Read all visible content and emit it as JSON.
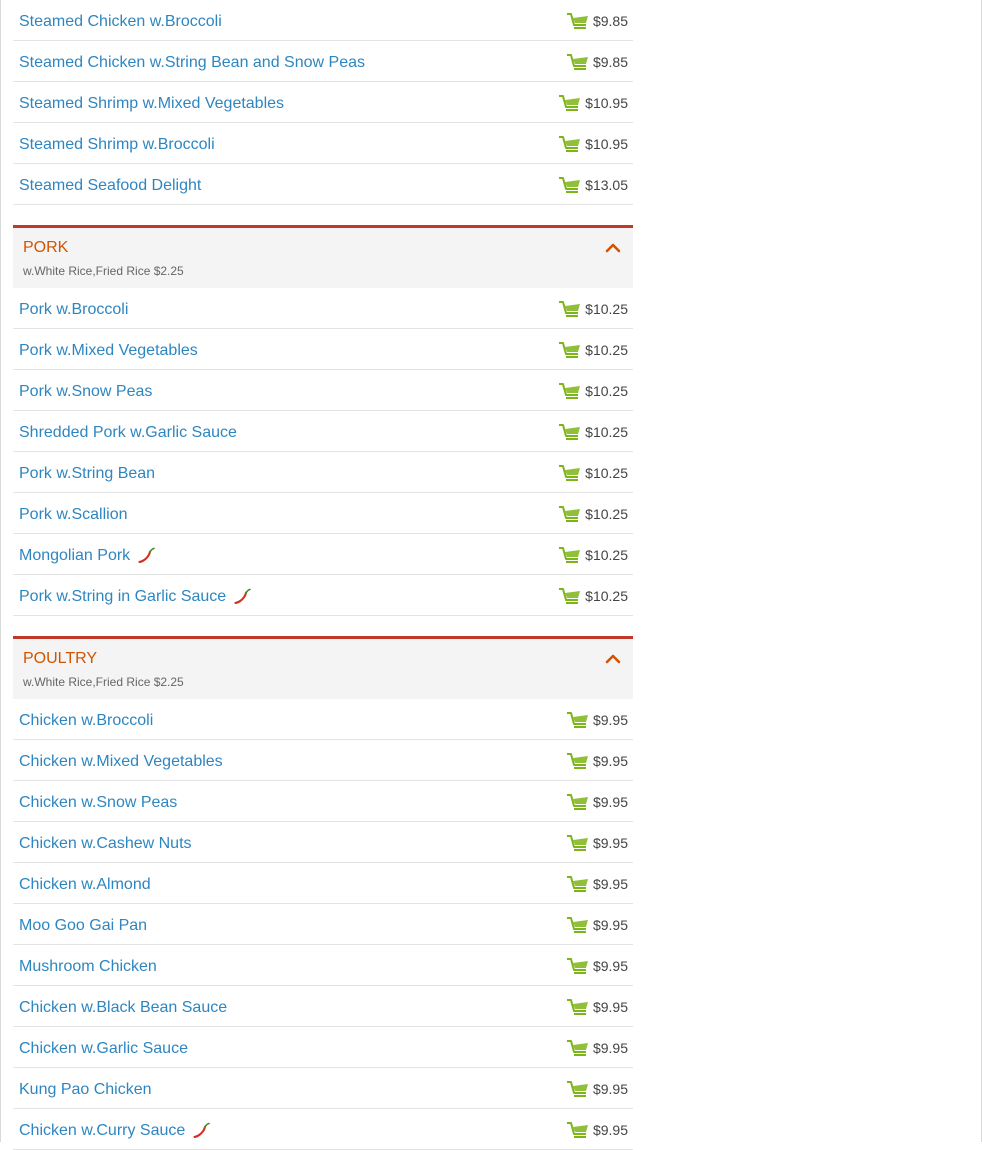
{
  "colors": {
    "link": "#2e86c1",
    "category": "#d35400",
    "divider": "#c0392b",
    "cart": "#7cb518",
    "pepper": "#d62d20"
  },
  "icons": {
    "cart": "shopping-cart-icon",
    "spicy": "chili-pepper-icon",
    "collapse": "chevron-up-icon"
  },
  "top_items": [
    {
      "name": "Steamed Chicken w.Broccoli",
      "price": "$9.85",
      "spicy": false
    },
    {
      "name": "Steamed Chicken w.String Bean and Snow Peas",
      "price": "$9.85",
      "spicy": false
    },
    {
      "name": "Steamed Shrimp w.Mixed Vegetables",
      "price": "$10.95",
      "spicy": false
    },
    {
      "name": "Steamed Shrimp w.Broccoli",
      "price": "$10.95",
      "spicy": false
    },
    {
      "name": "Steamed Seafood Delight",
      "price": "$13.05",
      "spicy": false
    }
  ],
  "categories": [
    {
      "title": "PORK",
      "subtitle": "w.White Rice,Fried Rice $2.25",
      "items": [
        {
          "name": "Pork w.Broccoli",
          "price": "$10.25",
          "spicy": false
        },
        {
          "name": "Pork w.Mixed Vegetables",
          "price": "$10.25",
          "spicy": false
        },
        {
          "name": "Pork w.Snow Peas",
          "price": "$10.25",
          "spicy": false
        },
        {
          "name": "Shredded Pork w.Garlic Sauce",
          "price": "$10.25",
          "spicy": false
        },
        {
          "name": "Pork w.String Bean",
          "price": "$10.25",
          "spicy": false
        },
        {
          "name": "Pork w.Scallion",
          "price": "$10.25",
          "spicy": false
        },
        {
          "name": "Mongolian Pork",
          "price": "$10.25",
          "spicy": true
        },
        {
          "name": "Pork w.String in Garlic Sauce",
          "price": "$10.25",
          "spicy": true
        }
      ]
    },
    {
      "title": "POULTRY",
      "subtitle": "w.White Rice,Fried Rice $2.25",
      "items": [
        {
          "name": "Chicken w.Broccoli",
          "price": "$9.95",
          "spicy": false
        },
        {
          "name": "Chicken w.Mixed Vegetables",
          "price": "$9.95",
          "spicy": false
        },
        {
          "name": "Chicken w.Snow Peas",
          "price": "$9.95",
          "spicy": false
        },
        {
          "name": "Chicken w.Cashew Nuts",
          "price": "$9.95",
          "spicy": false
        },
        {
          "name": "Chicken w.Almond",
          "price": "$9.95",
          "spicy": false
        },
        {
          "name": "Moo Goo Gai Pan",
          "price": "$9.95",
          "spicy": false
        },
        {
          "name": "Mushroom Chicken",
          "price": "$9.95",
          "spicy": false
        },
        {
          "name": "Chicken w.Black Bean Sauce",
          "price": "$9.95",
          "spicy": false
        },
        {
          "name": "Chicken w.Garlic Sauce",
          "price": "$9.95",
          "spicy": false
        },
        {
          "name": "Kung Pao Chicken",
          "price": "$9.95",
          "spicy": false
        },
        {
          "name": "Chicken w.Curry Sauce",
          "price": "$9.95",
          "spicy": true
        }
      ]
    }
  ]
}
